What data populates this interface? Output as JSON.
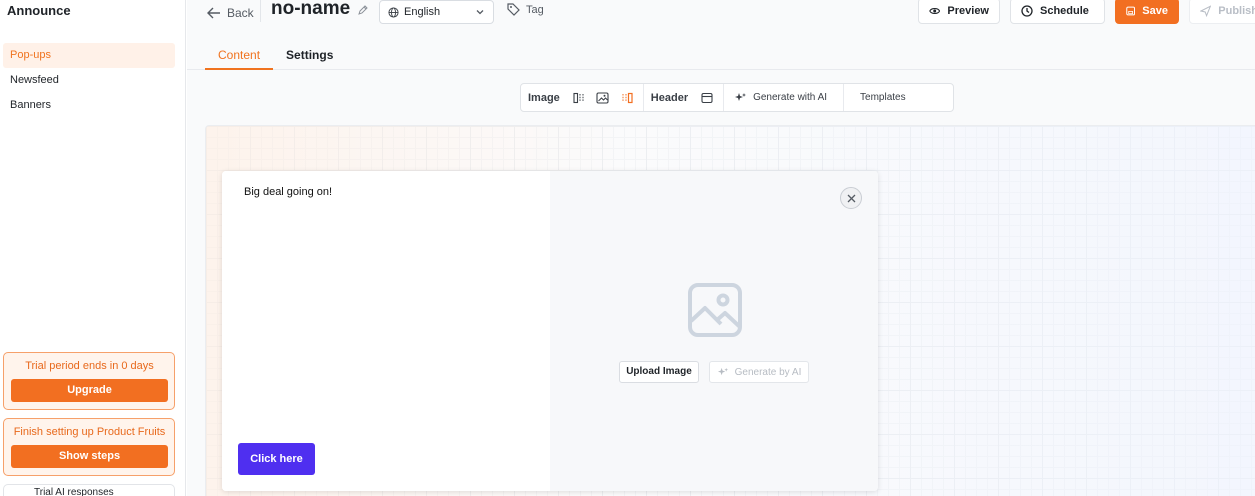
{
  "sidebar": {
    "app_title": "Announce",
    "items": [
      {
        "label": "Pop-ups",
        "active": true
      },
      {
        "label": "Newsfeed",
        "active": false
      },
      {
        "label": "Banners",
        "active": false
      }
    ],
    "trial": {
      "text": "Trial period ends in 0 days",
      "button": "Upgrade"
    },
    "setup": {
      "text": "Finish setting up Product Fruits",
      "button": "Show steps"
    },
    "ai": {
      "text": "Trial AI responses"
    }
  },
  "header": {
    "back_label": "Back",
    "doc_name": "no-name",
    "language": "English",
    "tag_label": "Tag",
    "preview_label": "Preview",
    "schedule_label": "Schedule",
    "save_label": "Save",
    "publish_label": "Publish"
  },
  "tabs": [
    {
      "label": "Content",
      "active": true
    },
    {
      "label": "Settings",
      "active": false
    }
  ],
  "toolbar": {
    "image_label": "Image",
    "header_label": "Header",
    "generate_label": "Generate with AI",
    "templates_label": "Templates"
  },
  "popup": {
    "text": "Big deal going on!",
    "cta_label": "Click here",
    "upload_label": "Upload Image",
    "generate_label": "Generate by AI"
  },
  "colors": {
    "accent": "#f26f21",
    "cta": "#4f2ff0"
  }
}
